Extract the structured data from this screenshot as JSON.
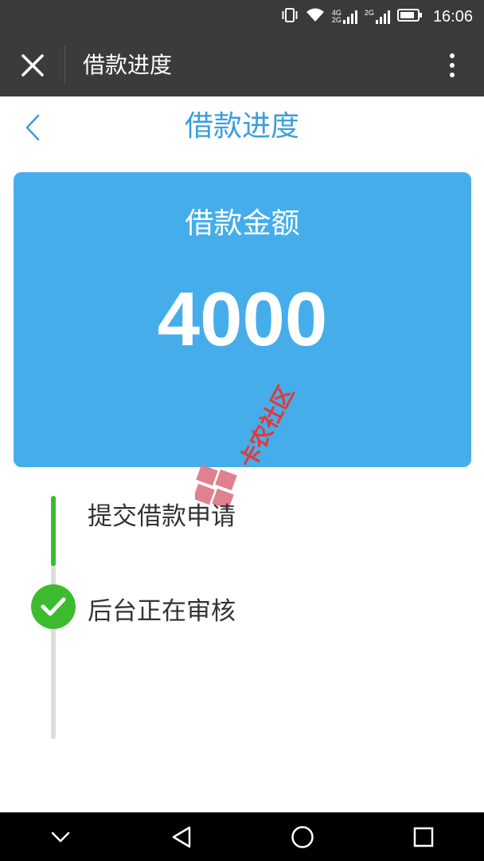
{
  "status_bar": {
    "signal_1_label_top": "4G",
    "signal_1_label_bottom": "2G",
    "signal_2_label": "2G",
    "time": "16:06",
    "icons": [
      "vibrate-icon",
      "wifi-icon",
      "signal-icon",
      "signal-icon",
      "battery-icon"
    ]
  },
  "title_bar": {
    "title": "借款进度",
    "close_icon": "close-icon",
    "more_icon": "more-vertical-icon"
  },
  "page_header": {
    "title": "借款进度",
    "back_icon": "chevron-left-icon"
  },
  "amount_card": {
    "label": "借款金额",
    "value": "4000"
  },
  "watermark": {
    "text": "卡农社区"
  },
  "timeline": {
    "progress_fraction": 0.29,
    "steps": [
      {
        "label": "提交借款申请",
        "status": "done"
      },
      {
        "label": "后台正在审核",
        "status": "current",
        "icon": "check-icon"
      }
    ]
  },
  "colors": {
    "accent": "#3a9fdc",
    "card": "#45aeea",
    "success": "#3dbb2e",
    "toolbar": "#3b3b3b"
  },
  "nav_bar": {
    "icons": [
      "chevron-down-icon",
      "back-triangle-icon",
      "home-circle-icon",
      "recents-square-icon"
    ]
  }
}
